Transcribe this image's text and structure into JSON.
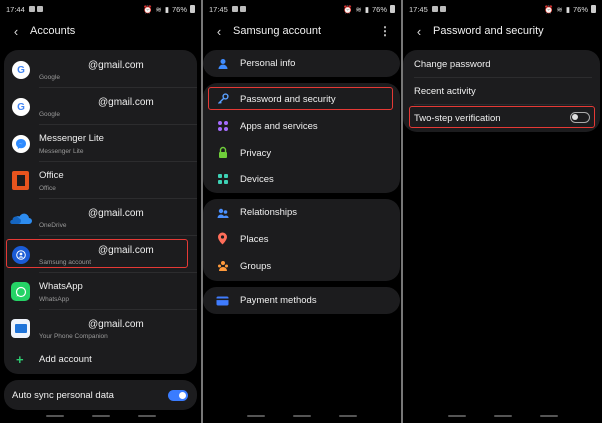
{
  "accounts_screen": {
    "status": {
      "time": "17:44",
      "battery": "76%"
    },
    "title": "Accounts",
    "accounts": [
      {
        "name": "@gmail.com",
        "type": "Google",
        "icon": "google-icon"
      },
      {
        "name": "@gmail.com",
        "type": "Google",
        "icon": "google-icon"
      },
      {
        "name": "Messenger Lite",
        "type": "Messenger Lite",
        "icon": "messenger-icon"
      },
      {
        "name": "Office",
        "type": "Office",
        "icon": "office-icon"
      },
      {
        "name": "@gmail.com",
        "type": "OneDrive",
        "icon": "onedrive-icon"
      },
      {
        "name": "@gmail.com",
        "type": "Samsung account",
        "icon": "samsung-account-icon"
      },
      {
        "name": "WhatsApp",
        "type": "WhatsApp",
        "icon": "whatsapp-icon"
      },
      {
        "name": "@gmail.com",
        "type": "Your Phone Companion",
        "icon": "your-phone-icon"
      }
    ],
    "add_account": "Add account",
    "auto_sync": {
      "label": "Auto sync personal data",
      "enabled": true
    }
  },
  "samsung_screen": {
    "status": {
      "time": "17:45",
      "battery": "76%"
    },
    "title": "Samsung account",
    "group1": [
      "Personal info"
    ],
    "group2": [
      "Password and security",
      "Apps and services",
      "Privacy",
      "Devices"
    ],
    "group3": [
      "Relationships",
      "Places",
      "Groups"
    ],
    "group4": [
      "Payment methods"
    ]
  },
  "security_screen": {
    "status": {
      "time": "17:45",
      "battery": "76%"
    },
    "title": "Password and security",
    "items": [
      "Change password",
      "Recent activity",
      "Two-step verification"
    ],
    "two_step_enabled": false
  },
  "colors": {
    "highlight": "#e53935",
    "toggle_on": "#3a7cff",
    "card_bg": "#1c1c1e"
  }
}
